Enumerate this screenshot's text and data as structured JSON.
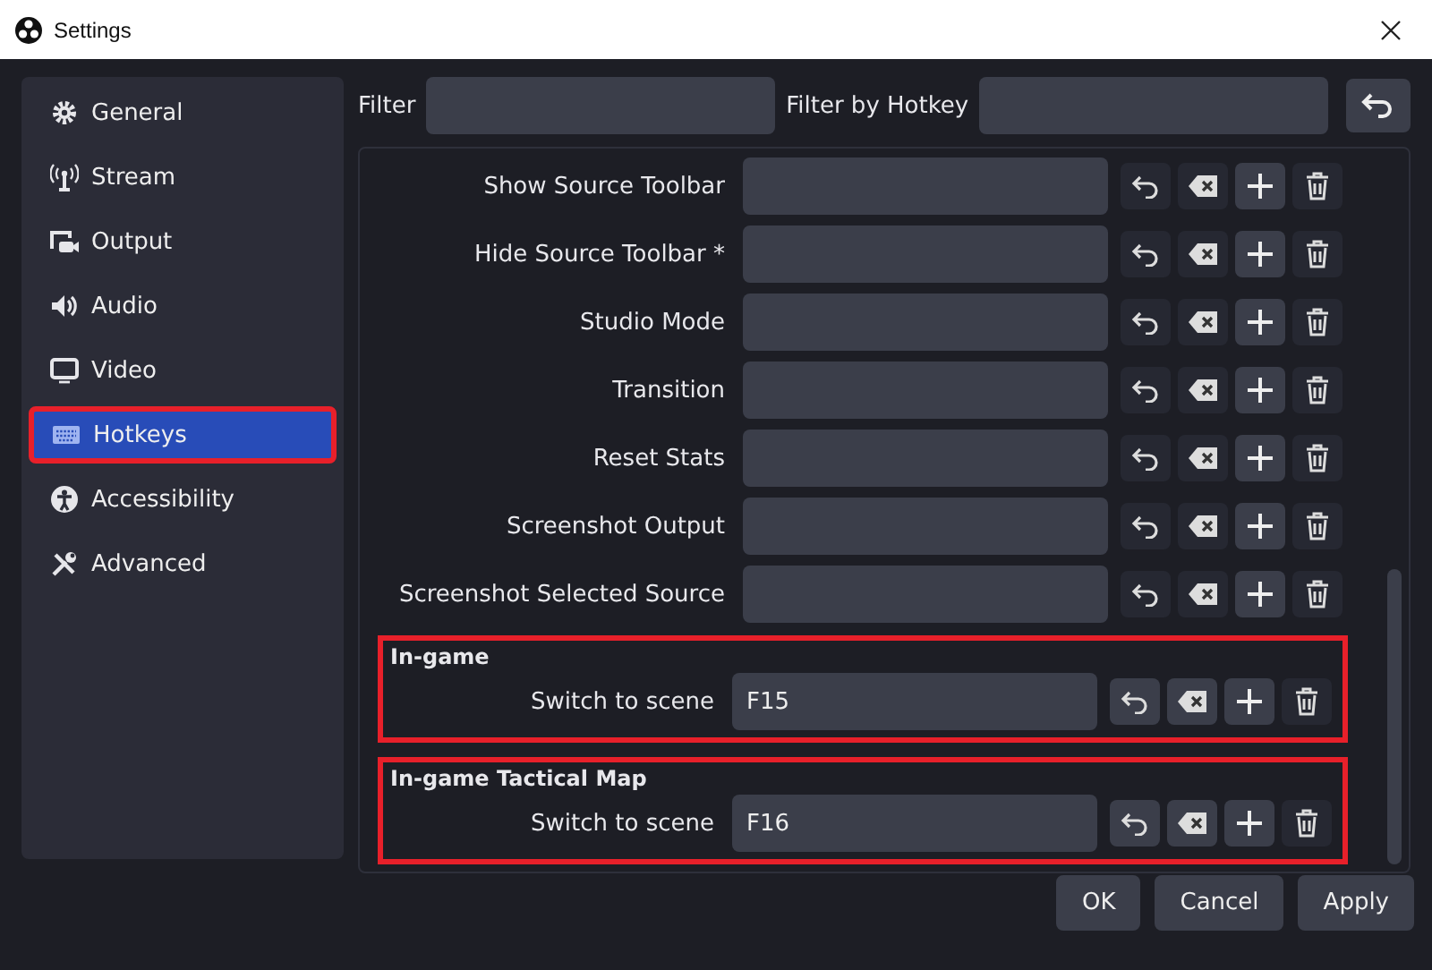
{
  "window": {
    "title": "Settings"
  },
  "sidebar": {
    "items": [
      {
        "label": "General",
        "selected": false,
        "highlighted": false
      },
      {
        "label": "Stream",
        "selected": false,
        "highlighted": false
      },
      {
        "label": "Output",
        "selected": false,
        "highlighted": false
      },
      {
        "label": "Audio",
        "selected": false,
        "highlighted": false
      },
      {
        "label": "Video",
        "selected": false,
        "highlighted": false
      },
      {
        "label": "Hotkeys",
        "selected": true,
        "highlighted": true
      },
      {
        "label": "Accessibility",
        "selected": false,
        "highlighted": false
      },
      {
        "label": "Advanced",
        "selected": false,
        "highlighted": false
      }
    ]
  },
  "filters": {
    "filter_label": "Filter",
    "hotkey_label": "Filter by Hotkey"
  },
  "hotkeys": [
    {
      "kind": "row",
      "label": "Show Source Toolbar",
      "revert_disabled": true,
      "clear_disabled": true
    },
    {
      "kind": "row",
      "label": "Hide Source Toolbar *",
      "revert_disabled": true,
      "clear_disabled": true
    },
    {
      "kind": "row",
      "label": "Studio Mode",
      "revert_disabled": true,
      "clear_disabled": true
    },
    {
      "kind": "row",
      "label": "Transition",
      "revert_disabled": true,
      "clear_disabled": true
    },
    {
      "kind": "row",
      "label": "Reset Stats",
      "revert_disabled": true,
      "clear_disabled": true
    },
    {
      "kind": "row",
      "label": "Screenshot Output",
      "revert_disabled": true,
      "clear_disabled": true
    },
    {
      "kind": "row",
      "label": "Screenshot Selected Source",
      "revert_disabled": true,
      "clear_disabled": true
    },
    {
      "kind": "group",
      "title": "In-game",
      "highlighted": true,
      "rows": [
        {
          "label": "Switch to scene",
          "value": "F15",
          "revert_disabled": false,
          "clear_disabled": false
        }
      ]
    },
    {
      "kind": "group",
      "title": "In-game Tactical Map",
      "highlighted": true,
      "rows": [
        {
          "label": "Switch to scene",
          "value": "F16",
          "revert_disabled": false,
          "clear_disabled": false
        }
      ]
    }
  ],
  "buttons": [
    "OK",
    "Cancel",
    "Apply"
  ]
}
